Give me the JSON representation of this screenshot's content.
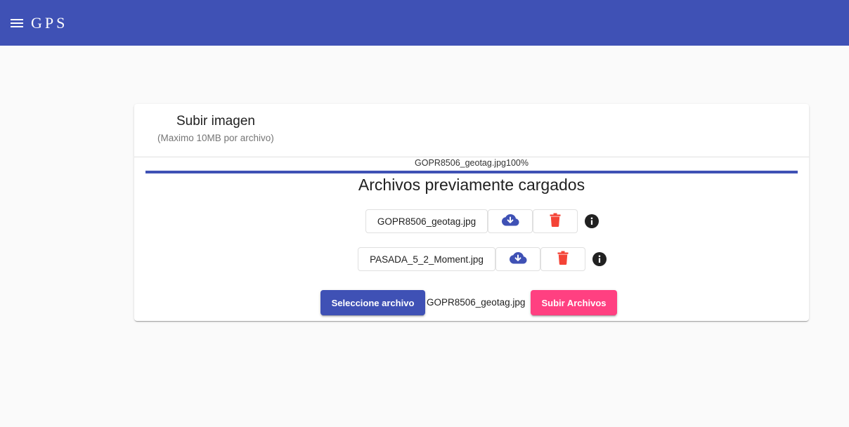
{
  "app": {
    "title": "GPS"
  },
  "colors": {
    "primary": "#3f51b5",
    "accent": "#ff4081",
    "delete": "#f44336"
  },
  "card": {
    "title": "Subir imagen",
    "subtitle": "(Maximo 10MB por archivo)"
  },
  "upload_progress": {
    "label": "GOPR8506_geotag.jpg100%",
    "percent": 100
  },
  "previous_files": {
    "title": "Archivos previamente cargados",
    "items": [
      {
        "name": "GOPR8506_geotag.jpg",
        "download_icon": "cloud-download-icon",
        "delete_icon": "trash-icon",
        "info_icon": "info-icon"
      },
      {
        "name": "PASADA_5_2_Moment.jpg",
        "download_icon": "cloud-download-icon",
        "delete_icon": "trash-icon",
        "info_icon": "info-icon"
      }
    ]
  },
  "actions": {
    "select_label": "Seleccione archivo",
    "selected_file": "GOPR8506_geotag.jpg",
    "upload_label": "Subir Archivos"
  }
}
